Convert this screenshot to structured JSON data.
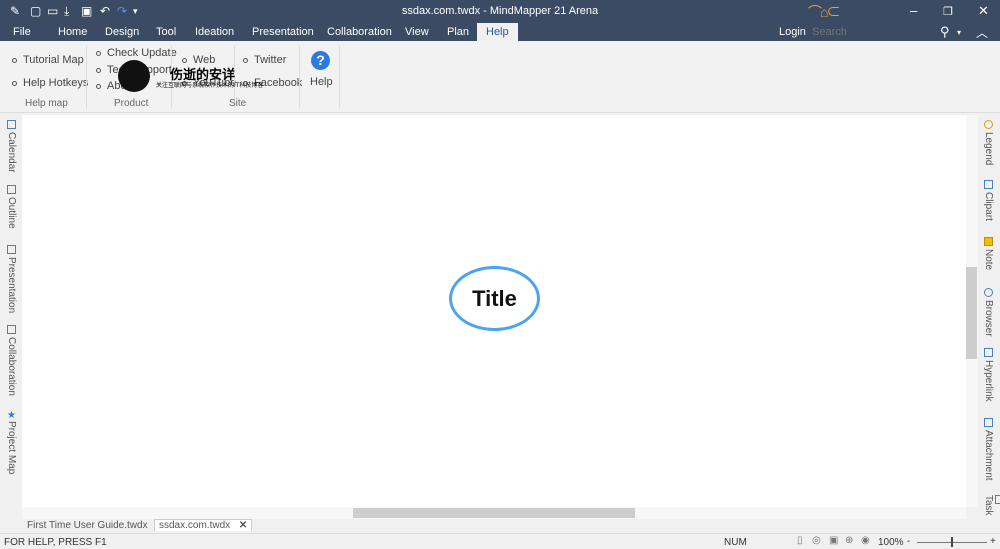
{
  "window": {
    "title": "ssdax.com.twdx - MindMapper 21 Arena",
    "quick_access_icons": [
      "paint-icon",
      "new-icon",
      "open-icon",
      "save-icon",
      "presentation-icon",
      "undo-icon",
      "redo-icon",
      "customize-icon"
    ]
  },
  "menu": {
    "tabs": [
      "File",
      "Home",
      "Design",
      "Tool",
      "Ideation",
      "Presentation",
      "Collaboration",
      "View",
      "Plan",
      "Help"
    ],
    "active": "Help",
    "login": "Login",
    "search_placeholder": "Search"
  },
  "ribbon": {
    "groups": [
      {
        "label": "Help map",
        "items": [
          "Tutorial Map",
          "Help Hotkeys"
        ]
      },
      {
        "label": "Product",
        "items": [
          "Check Update",
          "Tech Support",
          "About"
        ]
      },
      {
        "label": "Site",
        "items": [
          "Web",
          "YouTube",
          "Twitter",
          "Facebook"
        ]
      }
    ],
    "help_button": "Help",
    "watermark": {
      "title": "伤逝的安详",
      "subtitle": "关注互联网与系统软件技术的IT科技博客"
    }
  },
  "left_panels": [
    "Calendar",
    "Outline",
    "Presentation",
    "Collaboration",
    "Project Map"
  ],
  "right_panels": [
    "Legend",
    "Clipart",
    "Note",
    "Browser",
    "Hyperlink",
    "Attachment",
    "Task"
  ],
  "canvas": {
    "central_topic": "Title",
    "accent": "#4ca3f0"
  },
  "doc_tabs": [
    {
      "label": "First Time User Guide.twdx",
      "active": false
    },
    {
      "label": "ssdax.com.twdx",
      "active": true
    }
  ],
  "status": {
    "help_text": "FOR HELP, PRESS F1",
    "num": "NUM",
    "zoom": "100%",
    "zoom_minus": "-",
    "zoom_plus": "+"
  },
  "colors": {
    "titlebar": "#3b4b63",
    "logo": "#f0a020"
  }
}
